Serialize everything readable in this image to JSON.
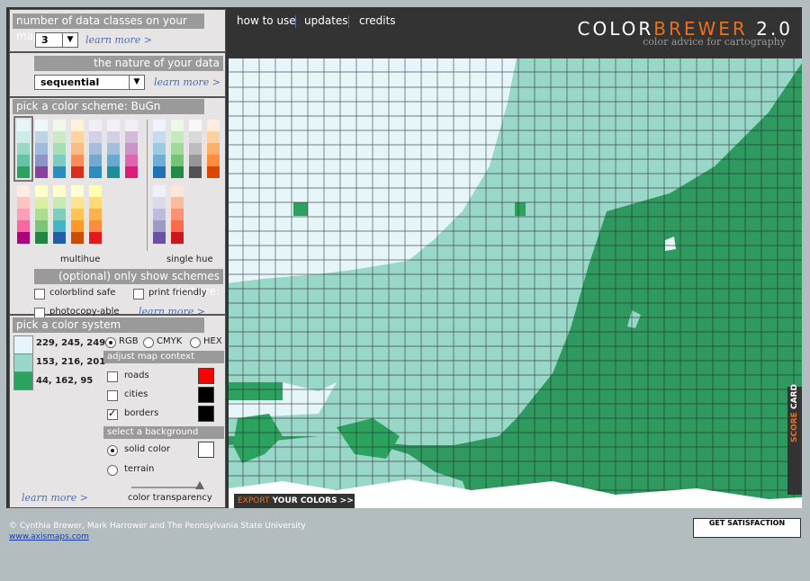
{
  "header": {
    "nav": [
      "how to use",
      "updates",
      "credits"
    ],
    "logo_a": "COLOR",
    "logo_b": "BREWER",
    "logo_c": " 2.0",
    "tagline": "color advice for cartography"
  },
  "classes": {
    "title": "number of data classes on your map",
    "value": "3",
    "learn": "learn more >"
  },
  "nature": {
    "title": "the nature of your data",
    "value": "sequential",
    "learn": "learn more >"
  },
  "scheme": {
    "title": "pick a color scheme: BuGn",
    "label_multi": "multihue",
    "label_single": "single hue"
  },
  "options": {
    "title": "(optional) only show schemes that are:",
    "colorblind": "colorblind safe",
    "print": "print friendly",
    "photocopy": "photocopy-able",
    "learn": "learn more >"
  },
  "system": {
    "title": "pick a color system",
    "swatches": [
      {
        "color": "#e5f5f9",
        "text": "229, 245, 249"
      },
      {
        "color": "#99d8c9",
        "text": "153, 216, 201"
      },
      {
        "color": "#2ca25f",
        "text": "44, 162, 95"
      }
    ],
    "rgb": "RGB",
    "cmyk": "CMYK",
    "hex": "HEX"
  },
  "context": {
    "title": "adjust map context",
    "roads": "roads",
    "cities": "cities",
    "borders": "borders",
    "bg_title": "select a background",
    "solid": "solid color",
    "terrain": "terrain",
    "transparency": "color transparency",
    "learn": "learn more >"
  },
  "map": {
    "export_a": "EXPORT",
    "export_b": " YOUR COLORS >>",
    "score_a": "SCORE",
    "score_b": " CARD"
  },
  "footer": {
    "copyright": "© Cynthia Brewer, Mark Harrower and The Pennsylvania State University",
    "link": "www.axismaps.com",
    "gs": "GET SATISFACTION"
  }
}
